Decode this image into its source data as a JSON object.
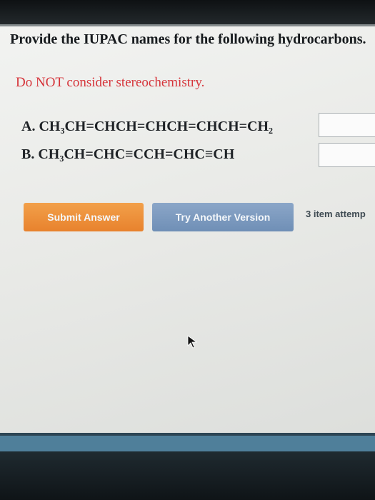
{
  "question": {
    "title": "Provide the IUPAC names for the following hydrocarbons.",
    "warning": "Do NOT consider stereochemistry.",
    "items": [
      {
        "label": "A.",
        "formula": "CH₃CH=CHCH=CHCH=CHCH=CH₂",
        "answer": ""
      },
      {
        "label": "B.",
        "formula": "CH₃CH=CHC≡CCH=CHC≡CH",
        "answer": ""
      }
    ]
  },
  "actions": {
    "submit_label": "Submit Answer",
    "try_another_label": "Try Another Version",
    "attempts_text": "3 item attemp"
  },
  "colors": {
    "warning": "#d6343a",
    "submit": "#e8822d",
    "try_another": "#6f8fb6"
  },
  "icons": [
    "mouse-pointer-icon"
  ]
}
